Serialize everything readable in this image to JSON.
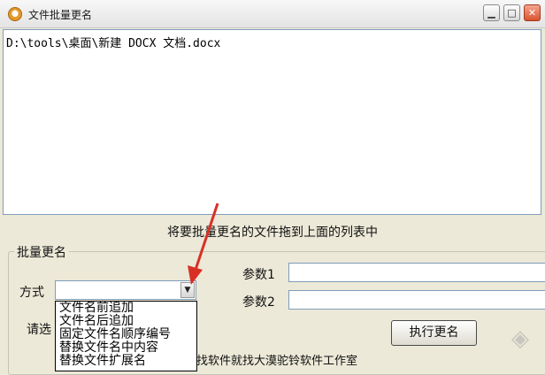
{
  "window": {
    "title": "文件批量更名",
    "controls": {
      "minimize": "▁",
      "maximize": "□",
      "close": "✕"
    }
  },
  "file_list": {
    "items": [
      "D:\\tools\\桌面\\新建 DOCX 文档.docx"
    ]
  },
  "hint": "将要批量更名的文件拖到上面的列表中",
  "group": {
    "title": "批量更名",
    "mode_label": "方式",
    "mode_value": "",
    "param1_label": "参数1",
    "param1_value": "",
    "param2_label": "参数2",
    "param2_value": "",
    "select_label": "请选",
    "run_button": "执行更名",
    "options": [
      "文件名前追加",
      "文件名后追加",
      "固定文件名顺序编号",
      "替换文件名中内容",
      "替换文件扩展名"
    ]
  },
  "footer": "找软件就找大漠驼铃软件工作室",
  "colors": {
    "arrow": "#d93025",
    "window_bg": "#ece9d8",
    "input_border": "#7f9db9"
  }
}
